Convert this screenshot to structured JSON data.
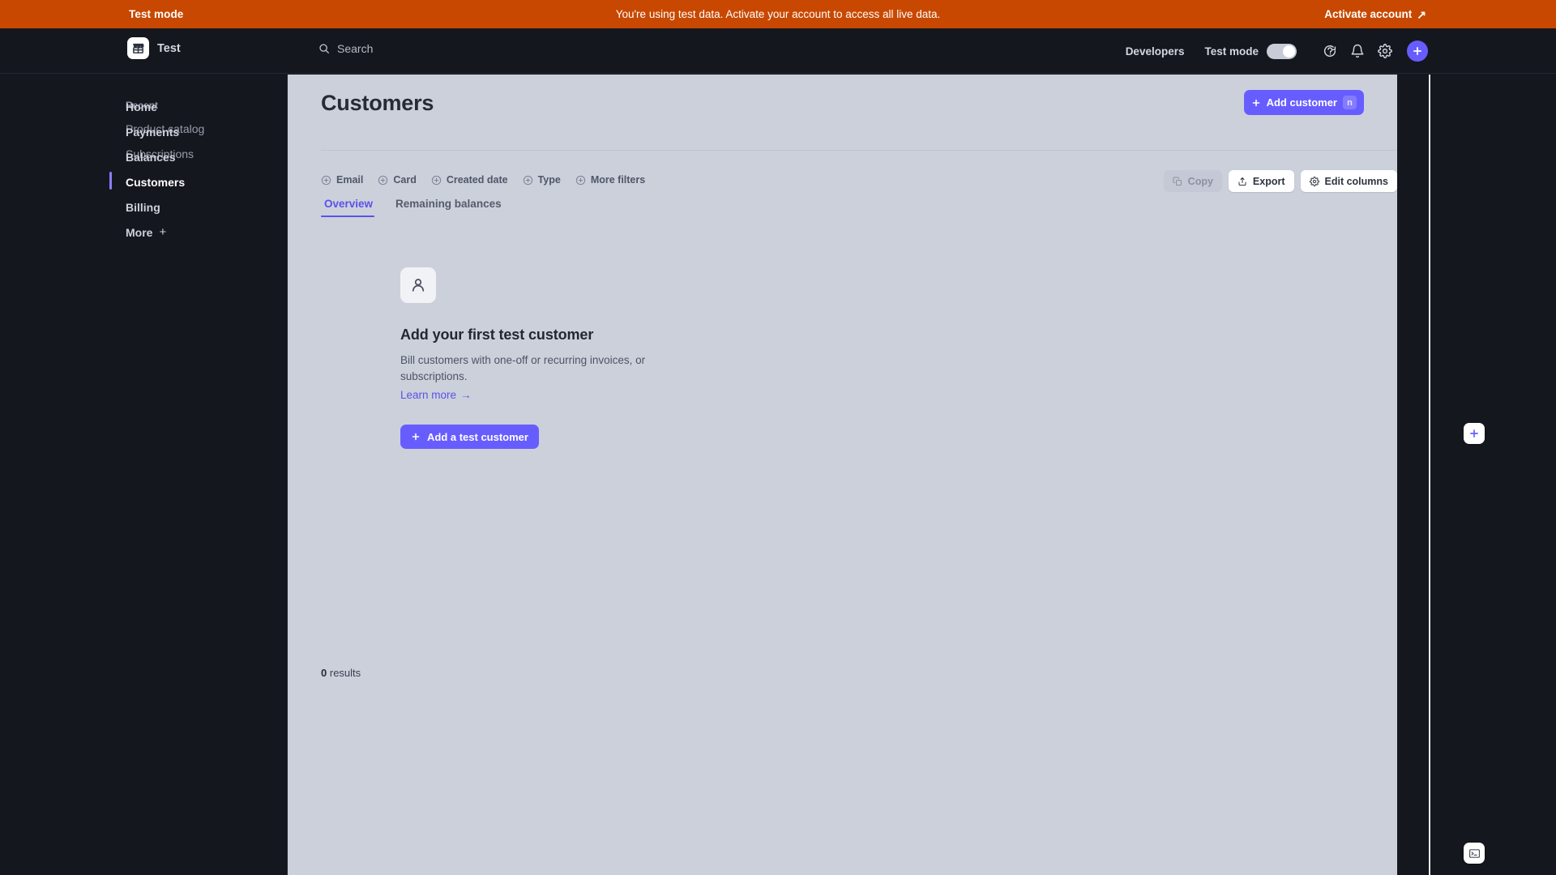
{
  "banner": {
    "left_label": "Test mode",
    "message": "You're using test data. Activate your account to access all live data.",
    "activate_label": "Activate account",
    "activate_icon": "external-link-arrow-icon",
    "bg_color": "#c84801"
  },
  "header": {
    "brand_name": "Test",
    "brand_logo_icon": "storefront-icon",
    "search_placeholder": "Search",
    "search_icon": "search-icon",
    "developers_label": "Developers",
    "test_mode_label": "Test mode",
    "test_mode_enabled": true,
    "help_icon": "help-circle-icon",
    "notifications_icon": "bell-icon",
    "settings_icon": "gear-icon",
    "add_icon": "plus-icon",
    "accent_color": "#675dff"
  },
  "sidebar": {
    "items": [
      {
        "label": "Home",
        "active": false
      },
      {
        "label": "Payments",
        "active": false
      },
      {
        "label": "Balances",
        "active": false
      },
      {
        "label": "Customers",
        "active": true
      },
      {
        "label": "Billing",
        "active": false
      },
      {
        "label": "More",
        "active": false,
        "suffix": "+"
      }
    ],
    "recent_heading": "Recent",
    "recent_items": [
      {
        "label": "Product catalog"
      },
      {
        "label": "Subscriptions"
      }
    ],
    "active_indicator_color": "#8c7dfb"
  },
  "main": {
    "title": "Customers",
    "add_customer": {
      "label": "Add customer",
      "icon": "plus-icon",
      "shortcut": "n"
    },
    "tabs": [
      {
        "label": "Overview",
        "active": true
      },
      {
        "label": "Remaining balances",
        "active": false
      }
    ],
    "filters": [
      {
        "label": "Email",
        "icon": "circle-plus-icon"
      },
      {
        "label": "Card",
        "icon": "circle-plus-icon"
      },
      {
        "label": "Created date",
        "icon": "circle-plus-icon"
      },
      {
        "label": "Type",
        "icon": "circle-plus-icon"
      },
      {
        "label": "More filters",
        "icon": "circle-plus-icon"
      }
    ],
    "actions": [
      {
        "label": "Copy",
        "icon": "copy-icon",
        "disabled": true
      },
      {
        "label": "Export",
        "icon": "export-icon",
        "disabled": false
      },
      {
        "label": "Edit columns",
        "icon": "gear-icon",
        "disabled": false
      }
    ],
    "empty_state": {
      "icon": "person-icon",
      "title": "Add your first test customer",
      "description": "Bill customers with one-off or recurring invoices, or subscriptions.",
      "learn_more_label": "Learn more",
      "learn_more_icon": "arrow-right-icon",
      "button_label": "Add a test customer",
      "button_icon": "plus-icon"
    },
    "results_count": "0",
    "results_label": "results"
  },
  "right_rail": {
    "add_icon": "plus-icon",
    "terminal_icon": "terminal-icon"
  }
}
